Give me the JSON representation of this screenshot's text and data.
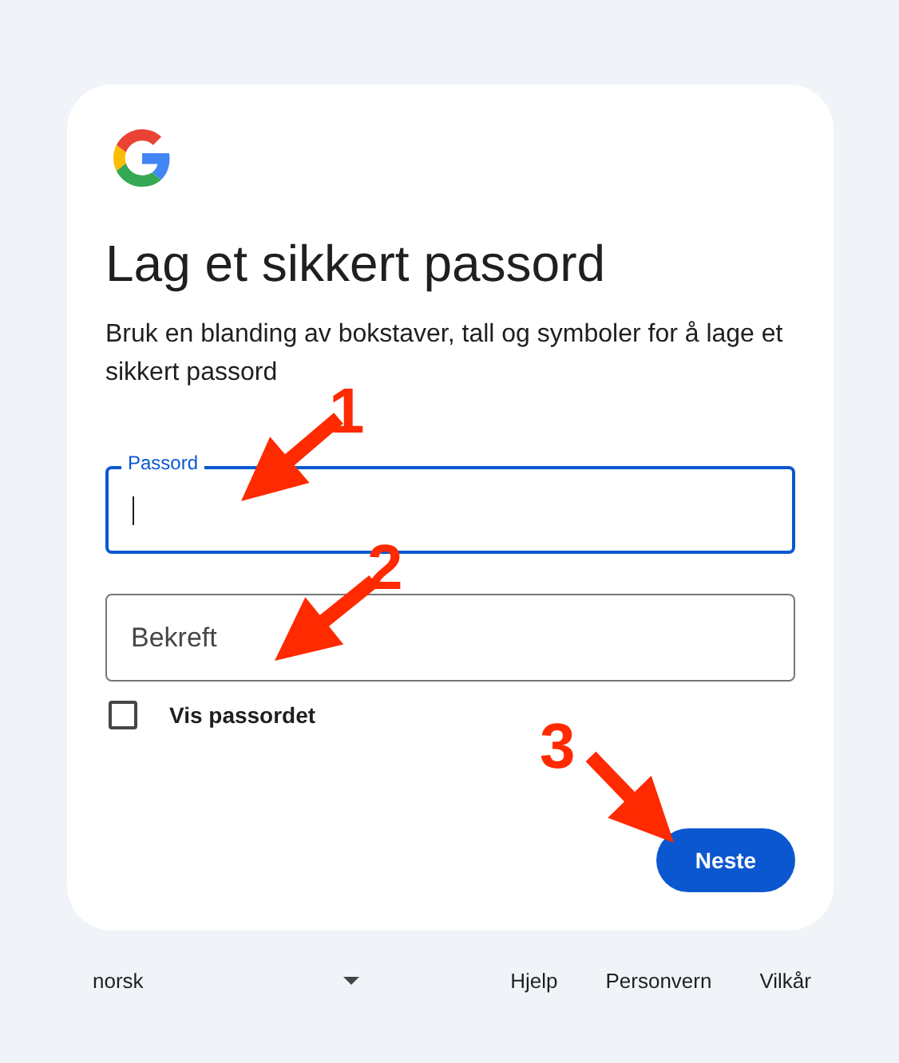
{
  "title": "Lag et sikkert passord",
  "description": "Bruk en blanding av bokstaver, tall og symboler for å lage et sikkert passord",
  "fields": [
    {
      "label": "Passord",
      "focused": true
    },
    {
      "placeholder": "Bekreft",
      "focused": false
    }
  ],
  "show_password": {
    "label": "Vis passordet",
    "checked": false
  },
  "next_button": "Neste",
  "footer": {
    "language": "norsk",
    "links": [
      "Hjelp",
      "Personvern",
      "Vilkår"
    ]
  },
  "annotations": [
    {
      "label": "1"
    },
    {
      "label": "2"
    },
    {
      "label": "3"
    }
  ]
}
